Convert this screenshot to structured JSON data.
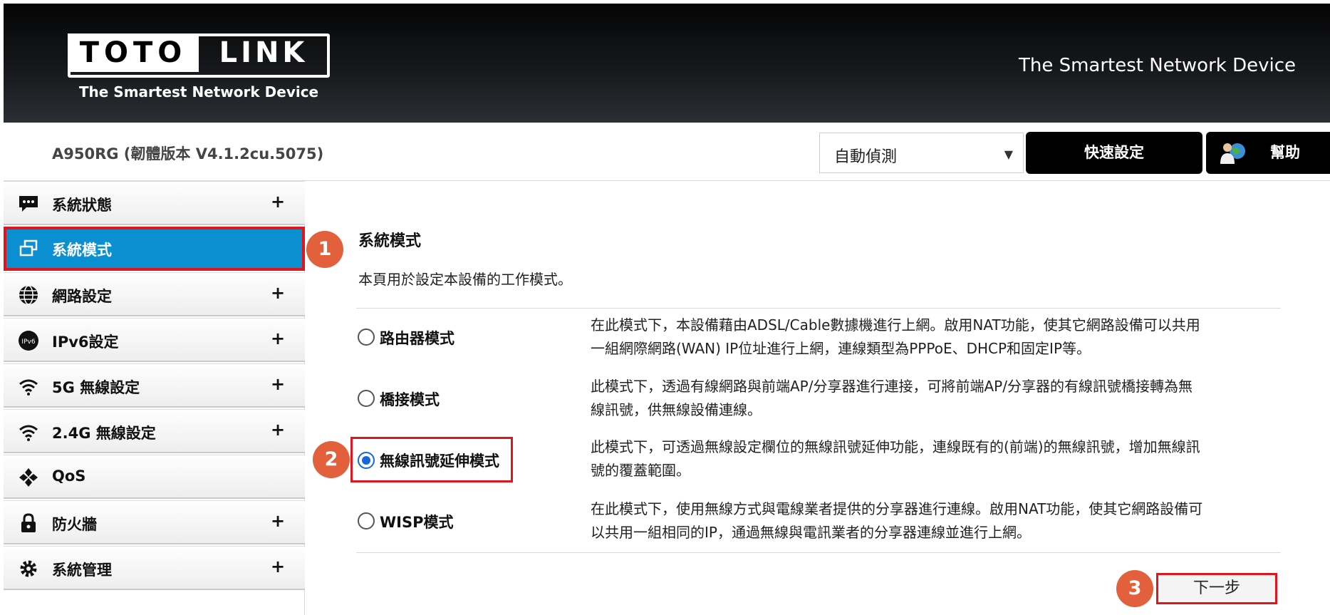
{
  "header": {
    "logo_left": "TOTO",
    "logo_right": "LINK",
    "logo_tagline": "The Smartest Network Device",
    "slogan": "The Smartest Network Device"
  },
  "topbar": {
    "model": "A950RG (韌體版本 V4.1.2cu.5075)",
    "language_selected": "自動偵測",
    "quick_setup_label": "快速設定",
    "help_label": "幫助"
  },
  "sidebar": {
    "items": [
      {
        "label": "系統狀態",
        "icon": "chat-bubble-icon",
        "expandable": true,
        "active": false
      },
      {
        "label": "系統模式",
        "icon": "windows-icon",
        "expandable": false,
        "active": true
      },
      {
        "label": "網路設定",
        "icon": "globe-icon",
        "expandable": true,
        "active": false
      },
      {
        "label": "IPv6設定",
        "icon": "ipv6-icon",
        "expandable": true,
        "active": false
      },
      {
        "label": "5G 無線設定",
        "icon": "wifi-icon",
        "expandable": true,
        "active": false
      },
      {
        "label": "2.4G 無線設定",
        "icon": "wifi-icon",
        "expandable": true,
        "active": false
      },
      {
        "label": "QoS",
        "icon": "qos-icon",
        "expandable": false,
        "active": false
      },
      {
        "label": "防火牆",
        "icon": "lock-icon",
        "expandable": true,
        "active": false
      },
      {
        "label": "系統管理",
        "icon": "gear-icon",
        "expandable": true,
        "active": false
      }
    ],
    "plus_symbol": "+"
  },
  "content": {
    "title": "系統模式",
    "description": "本頁用於設定本設備的工作模式。",
    "modes": [
      {
        "label": "路由器模式",
        "checked": false,
        "desc_line1": "在此模式下，本設備藉由ADSL/Cable數據機進行上網。啟用NAT功能，使其它網路設備可以共用",
        "desc_line2": "一組網際網路(WAN) IP位址進行上網，連線類型為PPPoE、DHCP和固定IP等。"
      },
      {
        "label": "橋接模式",
        "checked": false,
        "desc_line1": "此模式下，透過有線網路與前端AP/分享器進行連接，可將前端AP/分享器的有線訊號橋接轉為無",
        "desc_line2": "線訊號，供無線設備連線。"
      },
      {
        "label": "無線訊號延伸模式",
        "checked": true,
        "desc_line1": "此模式下，可透過無線設定欄位的無線訊號延伸功能，連線既有的(前端)的無線訊號，增加無線訊",
        "desc_line2": "號的覆蓋範圍。"
      },
      {
        "label": "WISP模式",
        "checked": false,
        "desc_line1": "在此模式下，使用無線方式與電線業者提供的分享器進行連線。啟用NAT功能，使其它網路設備可",
        "desc_line2": "以共用一組相同的IP，通過無線與電訊業者的分享器連線並進行上網。"
      }
    ],
    "next_label": "下一步"
  },
  "annotations": {
    "step1": "1",
    "step2": "2",
    "step3": "3"
  },
  "colors": {
    "active_nav": "#0a8fd0",
    "highlight": "#e0161e",
    "step_badge": "#e2603b",
    "radio_checked": "#1668d6"
  }
}
